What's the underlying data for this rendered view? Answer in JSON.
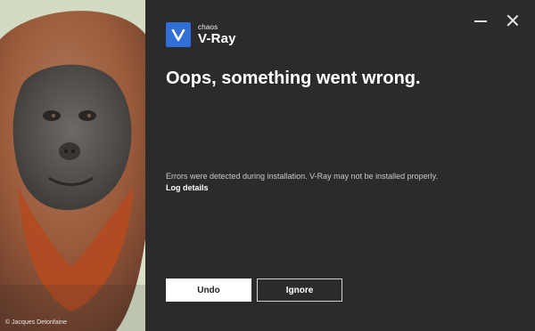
{
  "photo": {
    "credit": "© Jacques Detonfaine"
  },
  "brand": {
    "vendor": "chaos",
    "product": "V-Ray",
    "badge_color": "#2f6fd6"
  },
  "window_controls": {
    "minimize_icon": "minimize-icon",
    "close_icon": "close-icon"
  },
  "dialog": {
    "headline": "Oops, something went wrong.",
    "message": "Errors were detected during installation. V-Ray may not be installed properly.",
    "log_details_label": "Log details"
  },
  "buttons": {
    "undo_label": "Undo",
    "ignore_label": "Ignore"
  },
  "colors": {
    "background": "#2b2b2b",
    "primary_button_bg": "#ffffff",
    "secondary_button_border": "#d0d0d0"
  }
}
